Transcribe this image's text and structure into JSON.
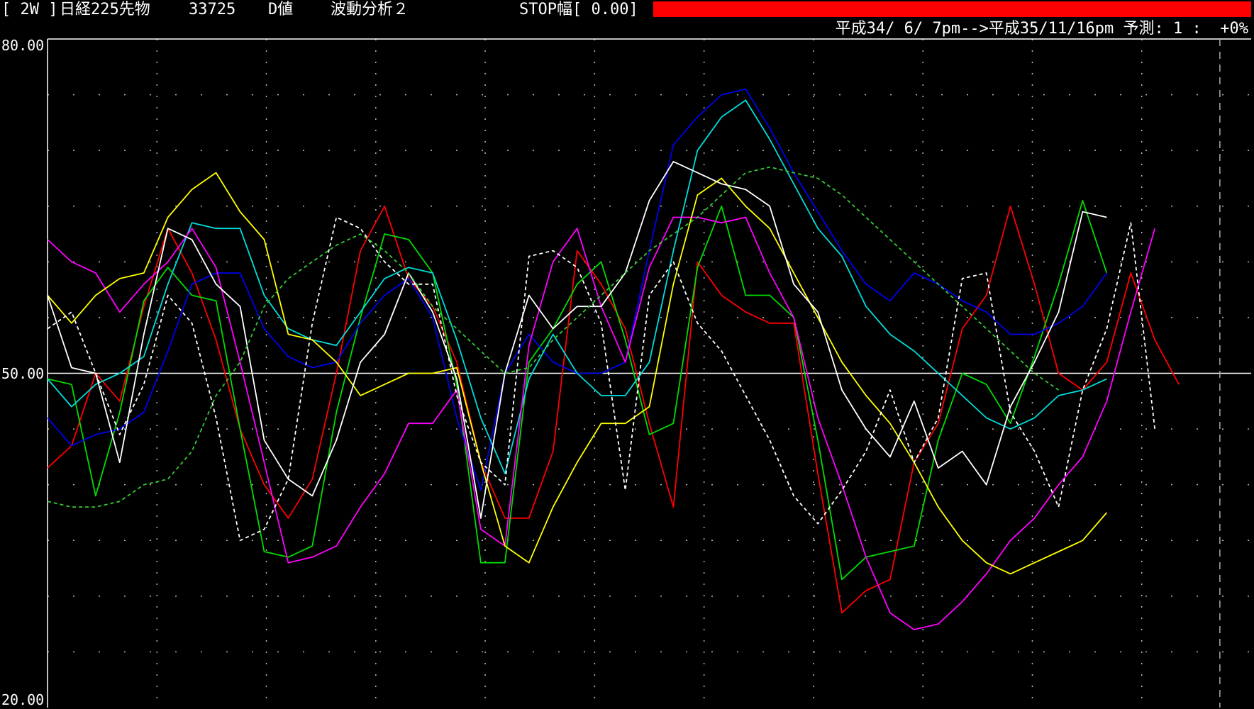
{
  "header": {
    "period_badge": "[ 2W ]",
    "instrument": "日経225先物",
    "price": "33725",
    "value_type": "D値",
    "analysis": "波動分析２",
    "stop_label": "STOP幅[ 0.00]",
    "stop_bar_color": "#ff0000",
    "range_text": "平成34/ 6/ 7pm-->平成35/11/16pm 予測: 1 :  +0%"
  },
  "chart_data": {
    "type": "line",
    "title": "",
    "xlabel": "",
    "ylabel": "",
    "ylim": [
      20,
      80
    ],
    "yticks": [
      "80.00",
      "50.00",
      "20.00"
    ],
    "reference_line": 50,
    "grid": true,
    "background": "#000000",
    "x": [
      1,
      2,
      3,
      4,
      5,
      6,
      7,
      8,
      9,
      10,
      11,
      12,
      13,
      14,
      15,
      16,
      17,
      18,
      19,
      20,
      21,
      22,
      23,
      24,
      25,
      26,
      27,
      28,
      29,
      30,
      31,
      32,
      33,
      34,
      35,
      36,
      37,
      38,
      39,
      40,
      41,
      42,
      43,
      44,
      45,
      46,
      47,
      48,
      49,
      50,
      51
    ],
    "series": [
      {
        "color": "#ff0000",
        "style": "solid",
        "values": [
          41.5,
          43.5,
          50,
          47.5,
          56,
          63,
          59,
          53,
          45,
          40,
          37,
          40.5,
          50,
          61,
          65,
          58.5,
          56,
          51,
          42,
          37,
          37,
          43,
          61,
          58,
          54,
          45.5,
          38,
          60,
          57,
          55.5,
          54.5,
          54.5,
          41,
          28.5,
          30.5,
          31.5,
          42,
          45.5,
          54,
          57,
          65,
          58,
          50,
          48.5,
          51,
          59,
          53,
          49
        ]
      },
      {
        "color": "#00dd00",
        "style": "solid",
        "values": [
          49.5,
          49,
          39,
          46.5,
          56.5,
          59.5,
          57,
          56.5,
          45,
          34,
          33.5,
          34.5,
          46.5,
          55,
          62.5,
          62,
          59,
          49,
          33,
          33,
          51,
          54,
          58,
          60,
          53,
          44.5,
          45.5,
          59.5,
          65,
          57,
          57,
          55,
          44,
          31.5,
          33.5,
          34,
          34.5,
          44,
          50,
          49,
          45.5,
          51.5,
          58,
          65.5,
          59
        ]
      },
      {
        "color": "#0000ee",
        "style": "solid",
        "values": [
          46,
          43.5,
          44.5,
          45,
          46.5,
          52,
          58,
          59,
          59,
          54,
          51.5,
          50.5,
          51,
          54.5,
          57,
          58.5,
          55,
          46,
          39.5,
          50,
          53.5,
          51,
          50,
          50,
          51,
          61,
          70.5,
          73,
          75,
          75.5,
          72,
          68,
          64.5,
          61,
          58,
          56.5,
          59,
          58,
          56.5,
          55.5,
          53.5,
          53.5,
          54.5,
          56,
          59
        ]
      },
      {
        "color": "#00dddd",
        "style": "solid",
        "values": [
          49.5,
          47,
          49,
          50,
          51.5,
          58,
          63.5,
          63,
          63,
          57,
          54,
          53,
          52.5,
          55.5,
          58.5,
          59.5,
          59,
          53,
          46,
          41,
          49.5,
          53.5,
          50,
          48,
          48,
          51,
          61,
          70,
          73,
          74.5,
          71,
          67,
          63,
          60.5,
          56,
          53.5,
          52,
          50,
          48,
          46,
          45,
          46,
          48,
          48.5,
          49.5
        ]
      },
      {
        "color": "#ff00ff",
        "style": "solid",
        "values": [
          62,
          60,
          59,
          55.5,
          58,
          60,
          63,
          59.5,
          51,
          42,
          33,
          33.5,
          34.5,
          38,
          41,
          45.5,
          45.5,
          48.5,
          36,
          34.5,
          52.5,
          60,
          63,
          56,
          51,
          59.5,
          64,
          64,
          63.5,
          64,
          59,
          55,
          46,
          40,
          33.5,
          28.5,
          27,
          27.5,
          29.5,
          32,
          35,
          37,
          40,
          42.5,
          47.5,
          55.5,
          63
        ]
      },
      {
        "color": "#ffff00",
        "style": "solid",
        "values": [
          57,
          54.5,
          57,
          58.5,
          59,
          64,
          66.5,
          68,
          64.5,
          62,
          53.5,
          53,
          51,
          48,
          49,
          50,
          50,
          50.5,
          42,
          34.5,
          33,
          38,
          42,
          45.5,
          45.5,
          47,
          58,
          66,
          67.5,
          65,
          63,
          59,
          55,
          51,
          48,
          45.5,
          42,
          38,
          35,
          33,
          32,
          33,
          34,
          35,
          37.5
        ]
      },
      {
        "color": "#ffffff",
        "style": "solid",
        "values": [
          57,
          50.5,
          50,
          42,
          53.5,
          63,
          62,
          58,
          56,
          44,
          40.5,
          39,
          44,
          51,
          53.5,
          59,
          55.5,
          49.5,
          37,
          50,
          57,
          54,
          56,
          56,
          59,
          65.5,
          69,
          68,
          67,
          66.5,
          65,
          58,
          55.5,
          48.5,
          45,
          42.5,
          47.5,
          41.5,
          43,
          40,
          47,
          51,
          55.5,
          64.5,
          64
        ]
      },
      {
        "color": "#ffffff",
        "style": "dashed",
        "values": [
          54,
          55.5,
          50,
          44.5,
          49,
          57,
          54.5,
          46,
          35,
          36,
          40.5,
          54.5,
          64,
          63,
          60,
          58,
          58,
          48,
          42,
          40,
          60.5,
          61,
          59.5,
          54.5,
          39.5,
          57,
          60,
          54.5,
          52,
          48,
          44,
          39,
          36.5,
          39.5,
          43,
          48.5,
          42,
          46,
          58.5,
          59,
          46.5,
          43,
          38,
          48.5,
          54,
          63.5,
          45
        ]
      },
      {
        "color": "#33cc33",
        "style": "dashed",
        "values": [
          38.5,
          38,
          38,
          38.5,
          40,
          40.5,
          43,
          48,
          51,
          56,
          58.5,
          60,
          61.5,
          62.5,
          61,
          59,
          56,
          54,
          52,
          50,
          50.5,
          53,
          55,
          57,
          59,
          61,
          62.5,
          64,
          66,
          68,
          68.5,
          68,
          67.5,
          66,
          64,
          62,
          60,
          58,
          56,
          54,
          52,
          50,
          48.5
        ]
      }
    ]
  }
}
